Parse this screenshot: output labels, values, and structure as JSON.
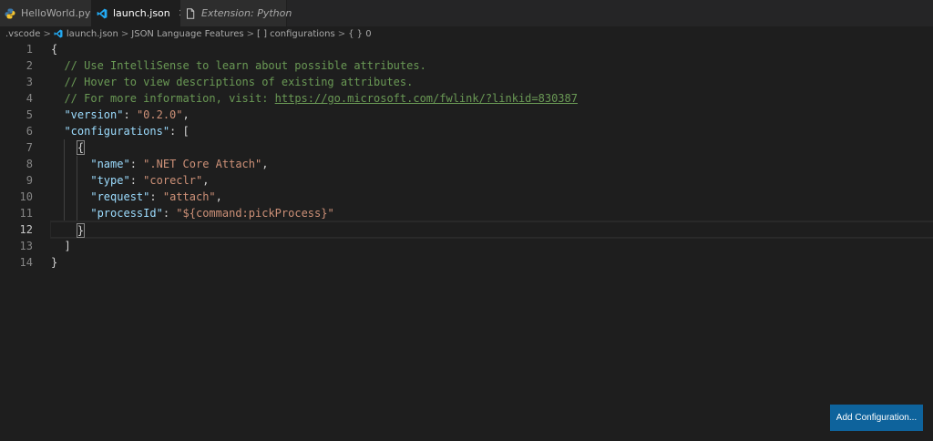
{
  "tabs": [
    {
      "label": "HelloWorld.py",
      "icon": "python-icon",
      "state": "inactive",
      "italic": false
    },
    {
      "label": "launch.json",
      "icon": "vscode-json-icon",
      "state": "active",
      "italic": false,
      "close": "✕"
    },
    {
      "label": "Extension: Python",
      "icon": "file-icon",
      "state": "inactive",
      "italic": true
    }
  ],
  "breadcrumb": {
    "items": [
      ".vscode",
      "launch.json",
      "JSON Language Features",
      "[ ] configurations",
      "{ } 0"
    ],
    "separator": ">"
  },
  "editor": {
    "line_numbers": [
      "1",
      "2",
      "3",
      "4",
      "5",
      "6",
      "7",
      "8",
      "9",
      "10",
      "11",
      "12",
      "13",
      "14"
    ],
    "current_line": 12,
    "lines": [
      [
        {
          "t": "punc",
          "v": "{"
        }
      ],
      [
        {
          "t": "cmt",
          "v": "  // Use IntelliSense to learn about possible attributes."
        }
      ],
      [
        {
          "t": "cmt",
          "v": "  // Hover to view descriptions of existing attributes."
        }
      ],
      [
        {
          "t": "cmt",
          "v": "  // For more information, visit: "
        },
        {
          "t": "link",
          "v": "https://go.microsoft.com/fwlink/?linkid=830387"
        }
      ],
      [
        {
          "t": "punc",
          "v": "  "
        },
        {
          "t": "key",
          "v": "\"version\""
        },
        {
          "t": "punc",
          "v": ": "
        },
        {
          "t": "str",
          "v": "\"0.2.0\""
        },
        {
          "t": "punc",
          "v": ","
        }
      ],
      [
        {
          "t": "punc",
          "v": "  "
        },
        {
          "t": "key",
          "v": "\"configurations\""
        },
        {
          "t": "punc",
          "v": ": ["
        }
      ],
      [
        {
          "t": "punc",
          "v": "    "
        },
        {
          "t": "bracket",
          "v": "{"
        }
      ],
      [
        {
          "t": "punc",
          "v": "      "
        },
        {
          "t": "key",
          "v": "\"name\""
        },
        {
          "t": "punc",
          "v": ": "
        },
        {
          "t": "str",
          "v": "\".NET Core Attach\""
        },
        {
          "t": "punc",
          "v": ","
        }
      ],
      [
        {
          "t": "punc",
          "v": "      "
        },
        {
          "t": "key",
          "v": "\"type\""
        },
        {
          "t": "punc",
          "v": ": "
        },
        {
          "t": "str",
          "v": "\"coreclr\""
        },
        {
          "t": "punc",
          "v": ","
        }
      ],
      [
        {
          "t": "punc",
          "v": "      "
        },
        {
          "t": "key",
          "v": "\"request\""
        },
        {
          "t": "punc",
          "v": ": "
        },
        {
          "t": "str",
          "v": "\"attach\""
        },
        {
          "t": "punc",
          "v": ","
        }
      ],
      [
        {
          "t": "punc",
          "v": "      "
        },
        {
          "t": "key",
          "v": "\"processId\""
        },
        {
          "t": "punc",
          "v": ": "
        },
        {
          "t": "str",
          "v": "\"${command:pickProcess}\""
        }
      ],
      [
        {
          "t": "punc",
          "v": "    "
        },
        {
          "t": "bracket",
          "v": "}"
        }
      ],
      [
        {
          "t": "punc",
          "v": "  ]"
        }
      ],
      [
        {
          "t": "punc",
          "v": "}"
        }
      ]
    ]
  },
  "button": {
    "label": "Add Configuration..."
  },
  "colors": {
    "background": "#1e1e1e",
    "comment": "#6a9955",
    "key": "#9cdcfe",
    "string": "#ce9178",
    "button": "#0e639c"
  }
}
